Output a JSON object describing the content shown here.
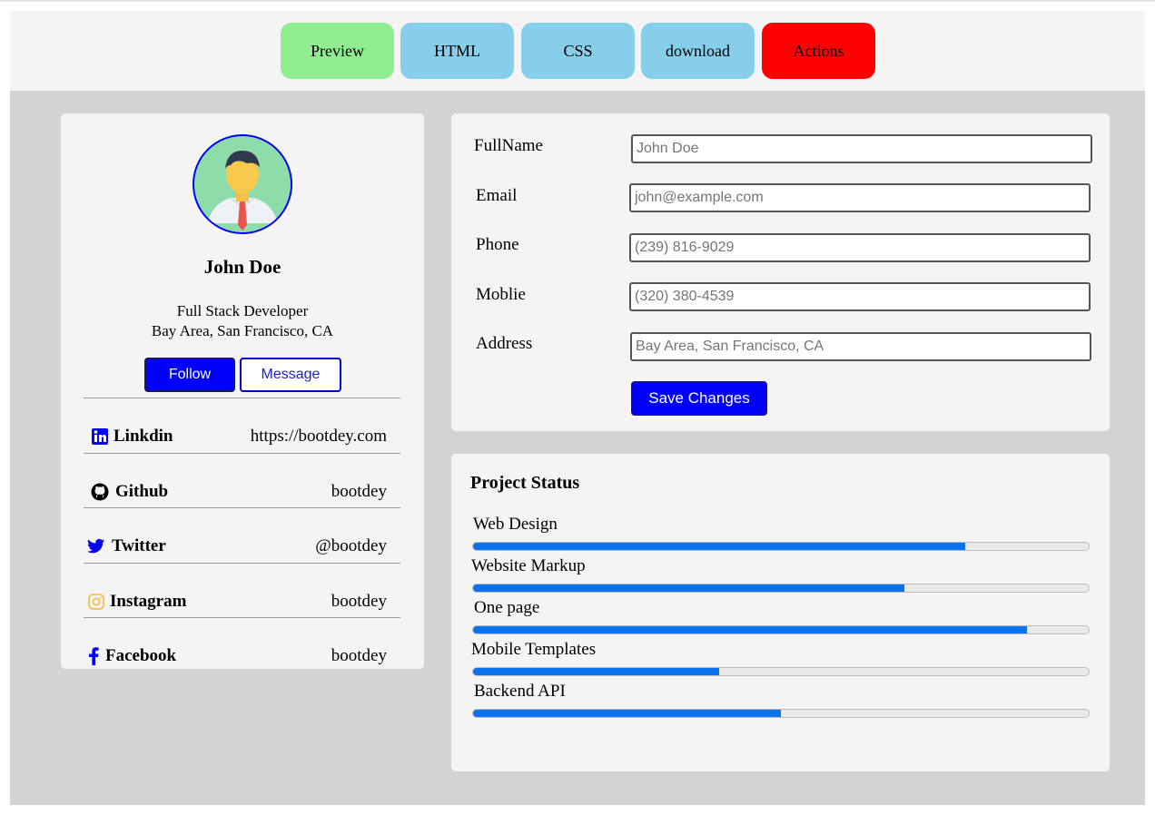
{
  "toolbar": {
    "buttons": [
      {
        "label": "Preview",
        "color": "#90ee90"
      },
      {
        "label": "HTML",
        "color": "#87ceeb"
      },
      {
        "label": "CSS",
        "color": "#87ceeb"
      },
      {
        "label": "download",
        "color": "#87ceeb"
      },
      {
        "label": "Actions",
        "color": "#ff0000"
      }
    ]
  },
  "profile": {
    "name": "John Doe",
    "role": "Full Stack Developer",
    "location": "Bay Area, San Francisco, CA",
    "follow_label": "Follow",
    "message_label": "Message",
    "socials": [
      {
        "label": "Linkdin",
        "value": "https://bootdey.com",
        "icon": "linkedin-icon"
      },
      {
        "label": "Github",
        "value": "bootdey",
        "icon": "github-icon"
      },
      {
        "label": "Twitter",
        "value": "@bootdey",
        "icon": "twitter-icon"
      },
      {
        "label": "Instagram",
        "value": "bootdey",
        "icon": "instagram-icon"
      },
      {
        "label": "Facebook",
        "value": "bootdey",
        "icon": "facebook-icon"
      }
    ]
  },
  "form": {
    "fields": [
      {
        "label": "FullName",
        "placeholder": "John Doe"
      },
      {
        "label": "Email",
        "placeholder": "john@example.com"
      },
      {
        "label": "Phone",
        "placeholder": "(239) 816-9029"
      },
      {
        "label": "Moblie",
        "placeholder": "(320) 380-4539"
      },
      {
        "label": "Address",
        "placeholder": "Bay Area, San Francisco, CA"
      }
    ],
    "save_label": "Save Changes"
  },
  "project_status": {
    "title": "Project Status",
    "projects": [
      {
        "label": "Web Design",
        "progress": 0.8
      },
      {
        "label": "Website Markup",
        "progress": 0.7
      },
      {
        "label": "One page",
        "progress": 0.9
      },
      {
        "label": "Mobile Templates",
        "progress": 0.4
      },
      {
        "label": "Backend API",
        "progress": 0.5
      }
    ]
  },
  "colors": {
    "primary": "#0000ff",
    "progress": "#0a72ee",
    "card": "#f4f4f4",
    "canvas": "#d3d3d3"
  }
}
